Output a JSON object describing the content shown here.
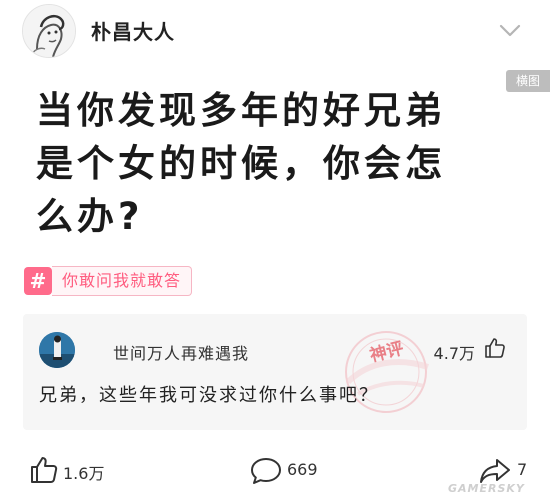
{
  "header": {
    "author_name": "朴昌大人",
    "layout_badge": "横图"
  },
  "post": {
    "title": "当你发现多年的好兄弟是个女的时候，你会怎么办?"
  },
  "tag": {
    "icon": "hash-icon",
    "symbol": "#",
    "label": "你敢问我就敢答"
  },
  "top_comment": {
    "user": "世间万人再难遇我",
    "likes": "4.7万",
    "text": "兄弟，这些年我可没求过你什么事吧？",
    "stamp": "神评"
  },
  "actions": {
    "like_count": "1.6万",
    "comment_count": "669",
    "share_count": "7"
  },
  "watermark": "GAMERSKY",
  "colors": {
    "accent_pink": "#ff5c7f",
    "stamp_red": "#e8747c"
  }
}
